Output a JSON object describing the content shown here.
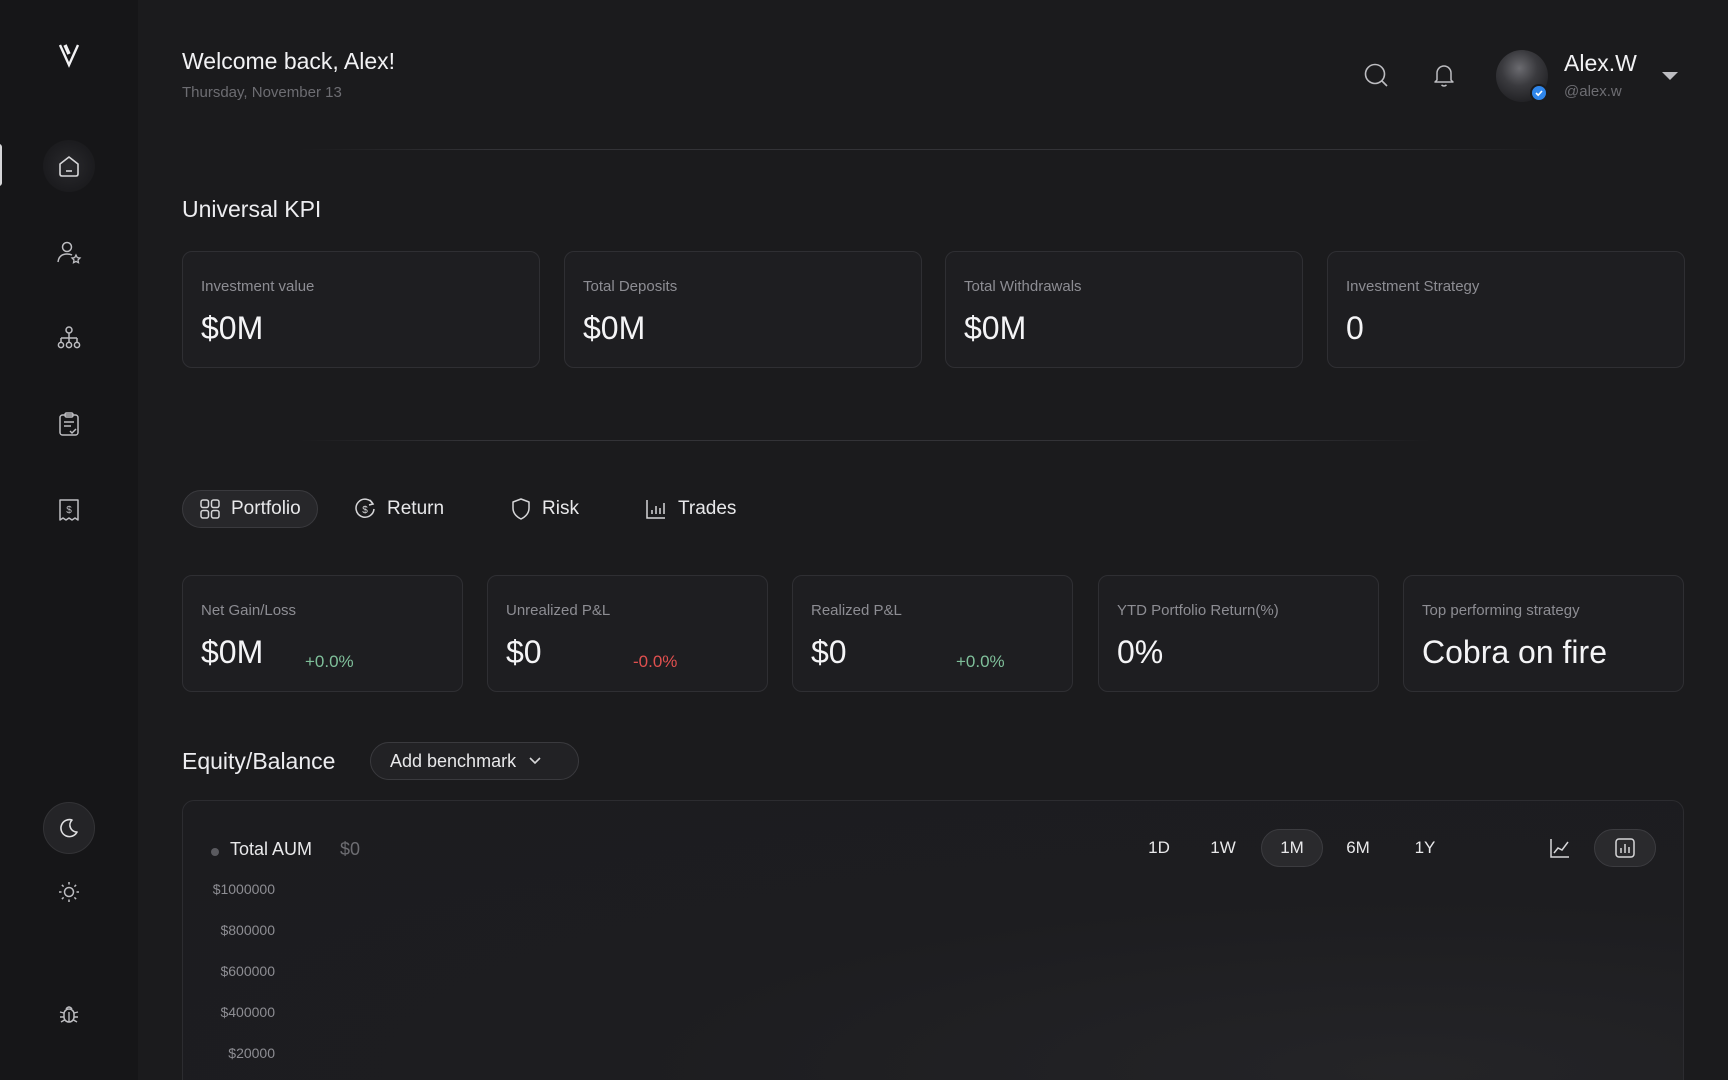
{
  "header": {
    "welcome": "Welcome back, Alex!",
    "date": "Thursday, November 13"
  },
  "user": {
    "name": "Alex.W",
    "handle": "@alex.w"
  },
  "kpi": {
    "title": "Universal KPI",
    "cards": [
      {
        "label": "Investment value",
        "value": "$0M"
      },
      {
        "label": "Total Deposits",
        "value": "$0M"
      },
      {
        "label": "Total Withdrawals",
        "value": "$0M"
      },
      {
        "label": "Investment Strategy",
        "value": "0"
      }
    ]
  },
  "tabs": [
    {
      "label": "Portfolio",
      "icon": "grid-icon",
      "active": true
    },
    {
      "label": "Return",
      "icon": "dollar-refresh-icon",
      "active": false
    },
    {
      "label": "Risk",
      "icon": "shield-icon",
      "active": false
    },
    {
      "label": "Trades",
      "icon": "bar-chart-icon",
      "active": false
    }
  ],
  "portfolio": {
    "cards": [
      {
        "label": "Net Gain/Loss",
        "value": "$0M",
        "change": "+0.0%",
        "trend": "positive"
      },
      {
        "label": "Unrealized P&L",
        "value": "$0",
        "change": "-0.0%",
        "trend": "negative"
      },
      {
        "label": "Realized P&L",
        "value": "$0",
        "change": "+0.0%",
        "trend": "positive"
      },
      {
        "label": "YTD Portfolio Return(%)",
        "value": "0%"
      },
      {
        "label": "Top performing strategy",
        "value": "Cobra on fire"
      }
    ]
  },
  "equity": {
    "title": "Equity/Balance",
    "benchmark_label": "Add benchmark",
    "legend_name": "Total AUM",
    "legend_value": "$0",
    "ranges": [
      "1D",
      "1W",
      "1M",
      "6M",
      "1Y"
    ],
    "active_range": "1M"
  },
  "colors": {
    "positive": "#7fbf9a",
    "negative": "#e0504f",
    "verified": "#2f86eb"
  },
  "chart_data": {
    "type": "bar",
    "title": "",
    "y_ticks": [
      "$1000000",
      "$800000",
      "$600000",
      "$400000",
      "$20000"
    ],
    "series": [],
    "categories": []
  }
}
